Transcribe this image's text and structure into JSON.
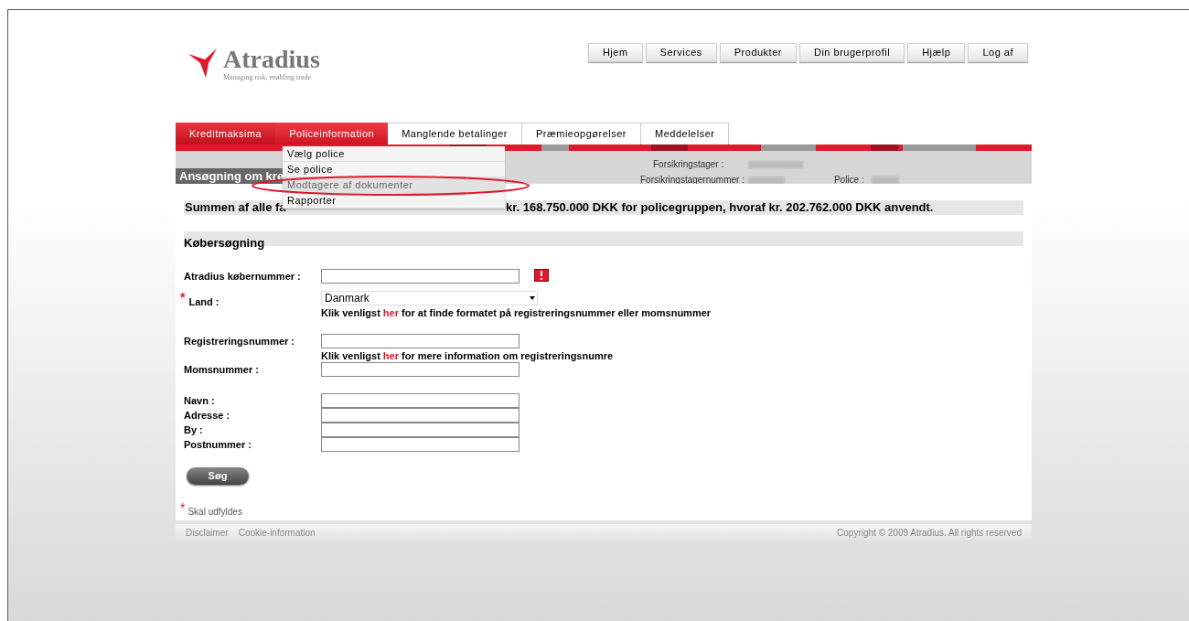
{
  "logo": {
    "name": "Atradius",
    "tagline": "Managing risk, enabling trade"
  },
  "top_nav": [
    "Hjem",
    "Services",
    "Produkter",
    "Din brugerprofil",
    "Hjælp",
    "Log af"
  ],
  "tabs": [
    {
      "label": "Kreditmaksima",
      "selected": true,
      "expanded": false
    },
    {
      "label": "Policeinformation",
      "selected": false,
      "expanded": true
    },
    {
      "label": "Manglende betalinger",
      "selected": false,
      "expanded": false
    },
    {
      "label": "Præmieopgørelser",
      "selected": false,
      "expanded": false
    },
    {
      "label": "Meddelelser",
      "selected": false,
      "expanded": false
    }
  ],
  "dropdown_menu": [
    {
      "label": "Vælg police",
      "highlighted": false
    },
    {
      "label": "Se police",
      "highlighted": false
    },
    {
      "label": "Modtagere af dokumenter",
      "highlighted": true
    },
    {
      "label": "Rapporter",
      "highlighted": false
    }
  ],
  "policy_info": {
    "holder_label": "Forsikringstager :",
    "number_label": "Forsikringstagernummer :",
    "police_label": "Police :"
  },
  "page_title": "Ansøgning om kre",
  "summary_parts": [
    "Summen af alle fa",
    "kr. 168.750.000 DKK for policegruppen, hvoraf kr. 202.762.000 DKK anvendt."
  ],
  "section_title": "Købersøgning",
  "field_groups": [
    [
      {
        "label": "Atradius købernummer :",
        "kind": "text",
        "required": false,
        "error": true
      }
    ],
    [
      {
        "label": "Land :",
        "kind": "select",
        "value": "Danmark",
        "required": true,
        "error": false,
        "hint": {
          "before": "Klik venligst",
          "link": "her",
          "after": "for at finde formatet på registreringsnummer eller momsnummer"
        }
      }
    ],
    [
      {
        "label": "Registreringsnummer :",
        "kind": "text",
        "required": false,
        "error": false,
        "hint": {
          "before": "Klik venligst",
          "link": "her",
          "after": "for mere information om registreringsnumre"
        }
      },
      {
        "label": "Momsnummer :",
        "kind": "text",
        "required": false,
        "error": false
      }
    ],
    [
      {
        "label": "Navn :",
        "kind": "text",
        "required": false,
        "error": false
      },
      {
        "label": "Adresse :",
        "kind": "text",
        "required": false,
        "error": false
      },
      {
        "label": "By :",
        "kind": "text",
        "required": false,
        "error": false
      },
      {
        "label": "Postnummer :",
        "kind": "text",
        "required": false,
        "error": false
      }
    ]
  ],
  "search_button": "Søg",
  "required_note": {
    "mark": "*",
    "text": "Skal udfyldes"
  },
  "footer": {
    "links": [
      "Disclaimer",
      "Cookie-information"
    ],
    "copyright": "Copyright © 2009 Atradius. All rights reserved"
  }
}
